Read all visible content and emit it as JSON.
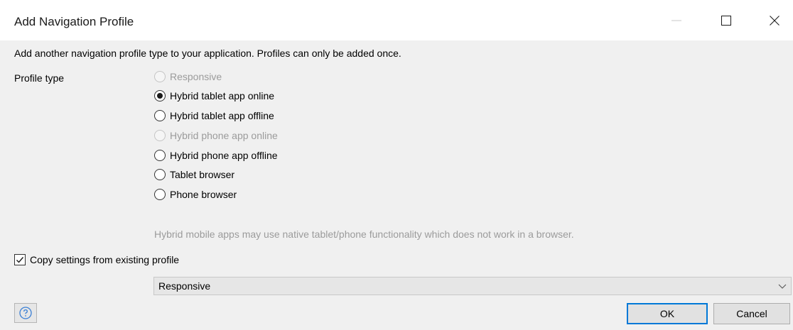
{
  "window": {
    "title": "Add Navigation Profile",
    "controls": [
      "minimize-icon",
      "maximize-icon",
      "close-icon"
    ]
  },
  "intro_text": "Add another navigation profile type to your application. Profiles can only be added once.",
  "profile_type": {
    "label": "Profile type",
    "options": [
      {
        "label": "Responsive",
        "selected": false,
        "disabled": true
      },
      {
        "label": "Hybrid tablet app online",
        "selected": true,
        "disabled": false
      },
      {
        "label": "Hybrid tablet app offline",
        "selected": false,
        "disabled": false
      },
      {
        "label": "Hybrid phone app online",
        "selected": false,
        "disabled": true
      },
      {
        "label": "Hybrid phone app offline",
        "selected": false,
        "disabled": false
      },
      {
        "label": "Tablet browser",
        "selected": false,
        "disabled": false
      },
      {
        "label": "Phone browser",
        "selected": false,
        "disabled": false
      }
    ]
  },
  "hint_text": "Hybrid mobile apps may use native tablet/phone functionality which does not work in a browser.",
  "copy_settings": {
    "label": "Copy settings from existing profile",
    "checked": true,
    "selected_profile": "Responsive"
  },
  "buttons": {
    "ok": "OK",
    "cancel": "Cancel",
    "help": "question-icon"
  },
  "colors": {
    "accent": "#0078d7",
    "background": "#f0f0f0",
    "disabled_text": "#9b9b9b"
  }
}
